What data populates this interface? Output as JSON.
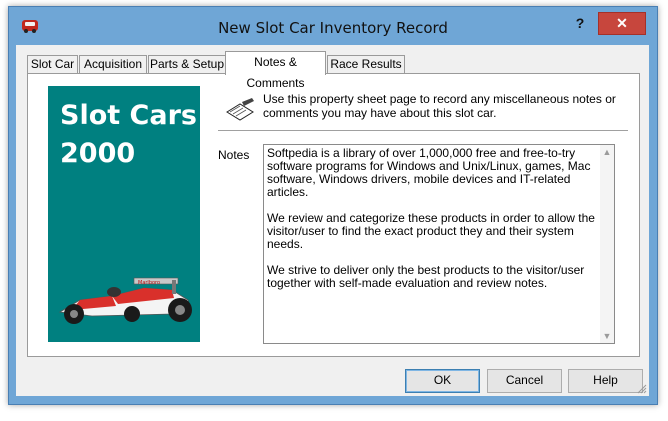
{
  "window": {
    "title": "New Slot Car Inventory Record",
    "help_label": "?",
    "close_label": "✕"
  },
  "tabs": [
    {
      "label": "Slot Car",
      "active": false
    },
    {
      "label": "Acquisition",
      "active": false
    },
    {
      "label": "Parts & Setup",
      "active": false
    },
    {
      "label": "Notes & Comments",
      "active": true
    },
    {
      "label": "Race Results",
      "active": false
    }
  ],
  "sidebar": {
    "brand_line1": "Slot Cars",
    "brand_line2": "2000",
    "background": "#008080"
  },
  "page": {
    "hint": "Use this property sheet page to record any miscellaneous notes or comments you may have about this slot car.",
    "notes_label": "Notes",
    "notes_paragraphs": [
      "Softpedia is a library of over 1,000,000 free and free-to-try software programs for Windows and Unix/Linux, games, Mac software, Windows drivers, mobile devices and IT-related articles.",
      "",
      "We review and categorize these products in order to allow the visitor/user to find the exact product they and their system needs.",
      "We strive to deliver only the best products to the visitor/user together with self-made evaluation and review notes."
    ]
  },
  "buttons": {
    "ok": "OK",
    "cancel": "Cancel",
    "help": "Help"
  },
  "colors": {
    "titlebar": "#6fa6d6",
    "close": "#c7463d"
  }
}
